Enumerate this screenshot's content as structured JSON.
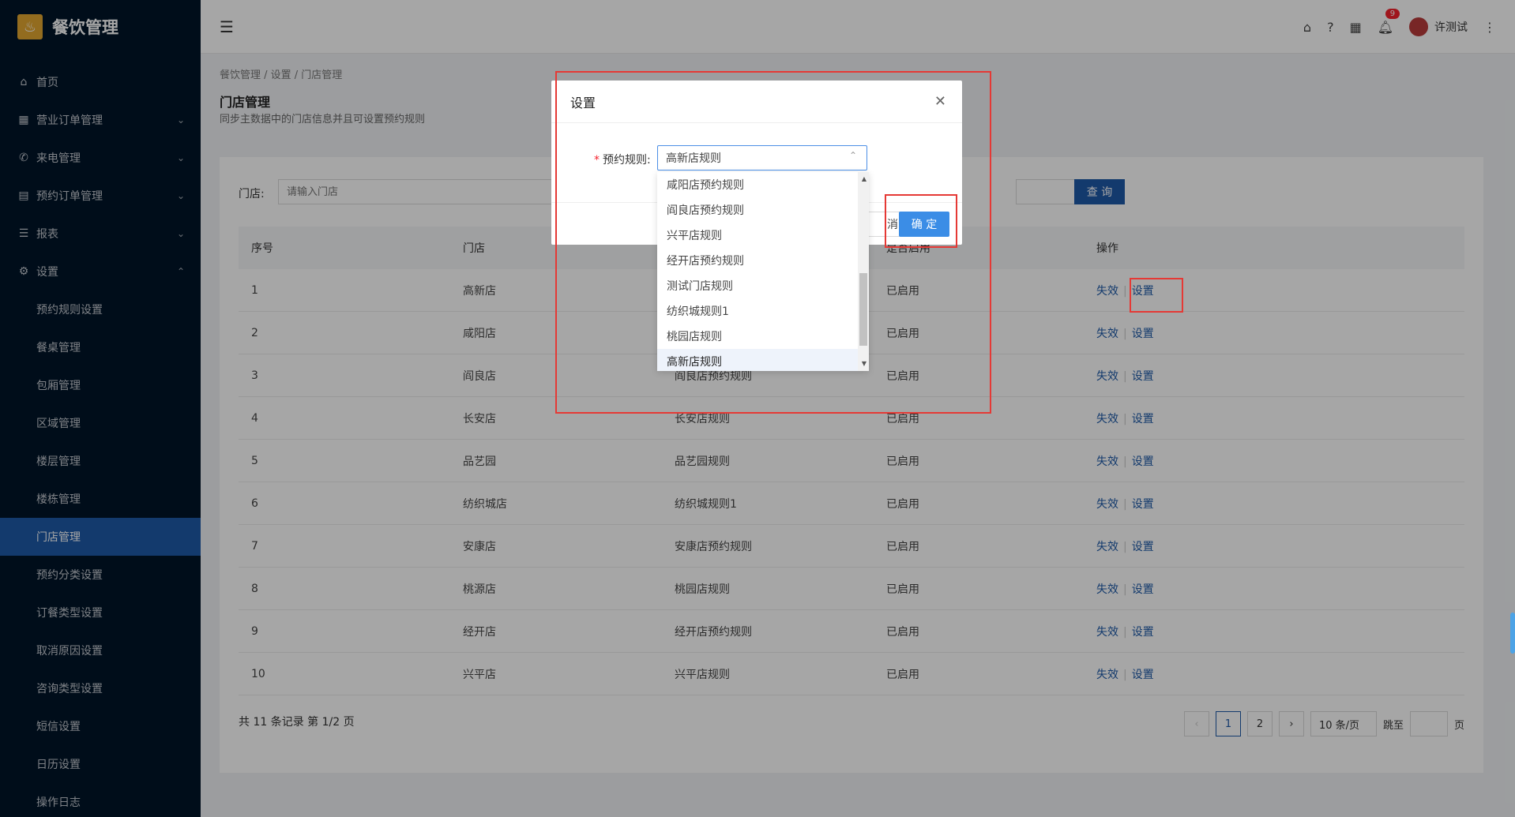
{
  "app": {
    "title": "餐饮管理",
    "logo_glyph": "♨"
  },
  "sidebar": {
    "items": [
      {
        "label": "首页",
        "icon": "⌂"
      },
      {
        "label": "营业订单管理",
        "icon": "▦",
        "chev": "⌄"
      },
      {
        "label": "来电管理",
        "icon": "✆",
        "chev": "⌄"
      },
      {
        "label": "预约订单管理",
        "icon": "▤",
        "chev": "⌄"
      },
      {
        "label": "报表",
        "icon": "☰",
        "chev": "⌄"
      },
      {
        "label": "设置",
        "icon": "⚙",
        "chev": "⌃"
      }
    ],
    "sub_items": [
      {
        "label": "预约规则设置"
      },
      {
        "label": "餐桌管理"
      },
      {
        "label": "包厢管理"
      },
      {
        "label": "区域管理"
      },
      {
        "label": "楼层管理"
      },
      {
        "label": "楼栋管理"
      },
      {
        "label": "门店管理"
      },
      {
        "label": "预约分类设置"
      },
      {
        "label": "订餐类型设置"
      },
      {
        "label": "取消原因设置"
      },
      {
        "label": "咨询类型设置"
      },
      {
        "label": "短信设置"
      },
      {
        "label": "日历设置"
      },
      {
        "label": "操作日志"
      }
    ]
  },
  "header": {
    "notification_count": "9",
    "username": "许测试"
  },
  "page": {
    "breadcrumb": "餐饮管理 / 设置 / 门店管理",
    "title": "门店管理",
    "subtitle": "同步主数据中的门店信息并且可设置预约规则"
  },
  "filter": {
    "store_label": "门店:",
    "store_placeholder": "请输入门店",
    "query_label": "查 询"
  },
  "table": {
    "headers": [
      "序号",
      "门店",
      "",
      "是否启用",
      "操作"
    ],
    "rows": [
      {
        "no": "1",
        "store": "高新店",
        "rule": "",
        "status": "已启用"
      },
      {
        "no": "2",
        "store": "咸阳店",
        "rule": "",
        "status": "已启用"
      },
      {
        "no": "3",
        "store": "阎良店",
        "rule": "阎良店预约规则",
        "status": "已启用"
      },
      {
        "no": "4",
        "store": "长安店",
        "rule": "长安店规则",
        "status": "已启用"
      },
      {
        "no": "5",
        "store": "品艺园",
        "rule": "品艺园规则",
        "status": "已启用"
      },
      {
        "no": "6",
        "store": "纺织城店",
        "rule": "纺织城规则1",
        "status": "已启用"
      },
      {
        "no": "7",
        "store": "安康店",
        "rule": "安康店预约规则",
        "status": "已启用"
      },
      {
        "no": "8",
        "store": "桃源店",
        "rule": "桃园店规则",
        "status": "已启用"
      },
      {
        "no": "9",
        "store": "经开店",
        "rule": "经开店预约规则",
        "status": "已启用"
      },
      {
        "no": "10",
        "store": "兴平店",
        "rule": "兴平店规则",
        "status": "已启用"
      }
    ],
    "action_disable": "失效",
    "action_set": "设置"
  },
  "pagination": {
    "total_text": "共 11 条记录 第 1/2 页",
    "pages": [
      "1",
      "2"
    ],
    "page_size": "10 条/页",
    "jump_label": "跳至",
    "page_unit": "页"
  },
  "modal": {
    "title": "设置",
    "field_label": "预约规则:",
    "selected_value": "高新店规则",
    "cancel_label": "消",
    "ok_label": "确 定",
    "options": [
      "咸阳店预约规则",
      "阎良店预约规则",
      "兴平店规则",
      "经开店预约规则",
      "测试门店规则",
      "纺织城规则1",
      "桃园店规则",
      "高新店规则"
    ]
  },
  "colors": {
    "primary": "#1e5aa8",
    "sidebar": "#001529",
    "annotation": "#e53935"
  }
}
